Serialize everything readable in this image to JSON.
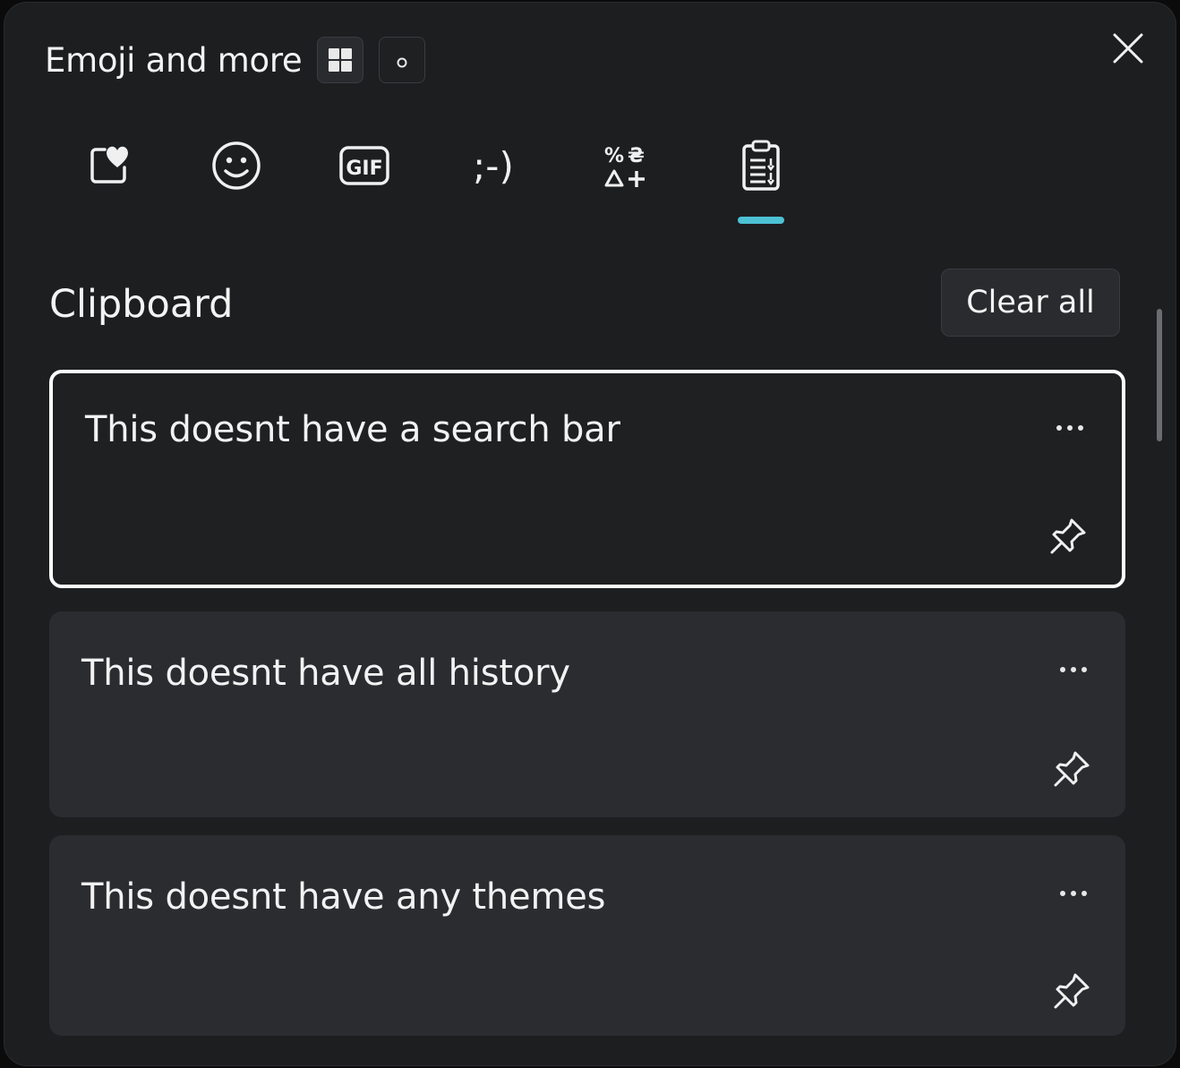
{
  "header": {
    "title": "Emoji and more",
    "mode_buttons": [
      {
        "icon": "grid-view-icon"
      },
      {
        "icon": "keyboard-mode-icon"
      }
    ],
    "close_icon": "close-icon"
  },
  "tabs": [
    {
      "icon": "favorites-heart-icon",
      "selected": false
    },
    {
      "icon": "emoji-smiley-icon",
      "selected": false
    },
    {
      "icon": "gif-icon",
      "selected": false
    },
    {
      "icon": "kaomoji-icon",
      "label": ";-)",
      "selected": false
    },
    {
      "icon": "symbols-icon",
      "selected": false
    },
    {
      "icon": "clipboard-icon",
      "selected": true
    }
  ],
  "accent_color": "#4cc2d4",
  "clipboard": {
    "title": "Clipboard",
    "clear_label": "Clear all",
    "items": [
      {
        "text": "This doesnt have a search bar",
        "focused": true
      },
      {
        "text": "This doesnt have all history",
        "focused": false
      },
      {
        "text": "This doesnt have any themes",
        "focused": false
      }
    ]
  }
}
